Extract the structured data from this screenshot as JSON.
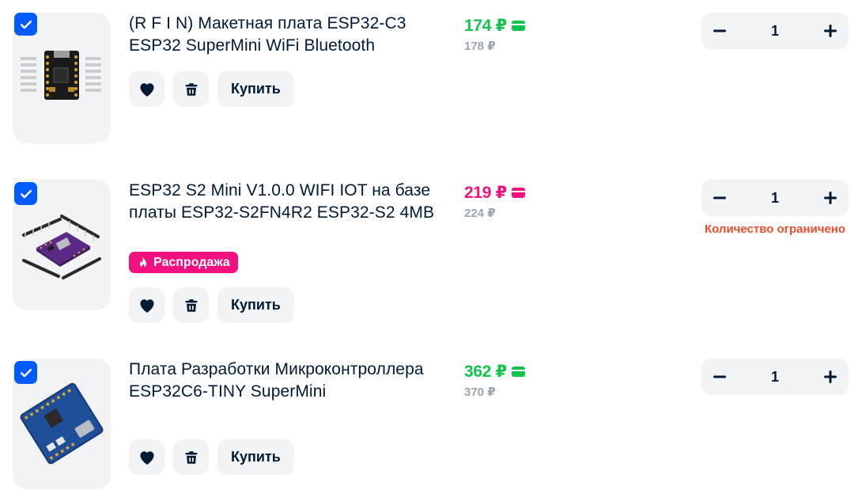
{
  "currency_symbol": "₽",
  "colors": {
    "accent": "#005bff",
    "price_green": "#10c44c",
    "price_pink": "#f1117e",
    "old_price": "#9aa4b0",
    "warning": "#f04b2a",
    "button_bg": "#f2f3f5"
  },
  "icons": {
    "checkbox": "checkmark-icon",
    "favorite": "heart-icon",
    "delete": "trash-icon",
    "payment": "card-icon",
    "sale": "fire-icon",
    "decrease": "minus-icon",
    "increase": "plus-icon"
  },
  "cart": {
    "items": [
      {
        "title": "(R F I N) Макетная плата ESP32-C3 ESP32 SuperMini WiFi Bluetooth",
        "price": "174 ₽",
        "old_price": "178 ₽",
        "selected": true,
        "buy_label": "Купить",
        "quantity": "1",
        "image": "board-black-supermini"
      },
      {
        "title": "ESP32 S2 Mini V1.0.0 WIFI IOT на базе платы ESP32-S2FN4R2 ESP32-S2 4MB",
        "price": "219 ₽",
        "old_price": "224 ₽",
        "selected": true,
        "badge": "Распродажа",
        "buy_label": "Купить",
        "quantity": "1",
        "stock_note": "Количество ограничено",
        "image": "board-purple-s2-mini"
      },
      {
        "title": "Плата Разработки Микроконтроллера ESP32C6-TINY SuperMini",
        "price": "362 ₽",
        "old_price": "370 ₽",
        "selected": true,
        "buy_label": "Купить",
        "quantity": "1",
        "image": "board-blue-c6-tiny"
      }
    ]
  }
}
